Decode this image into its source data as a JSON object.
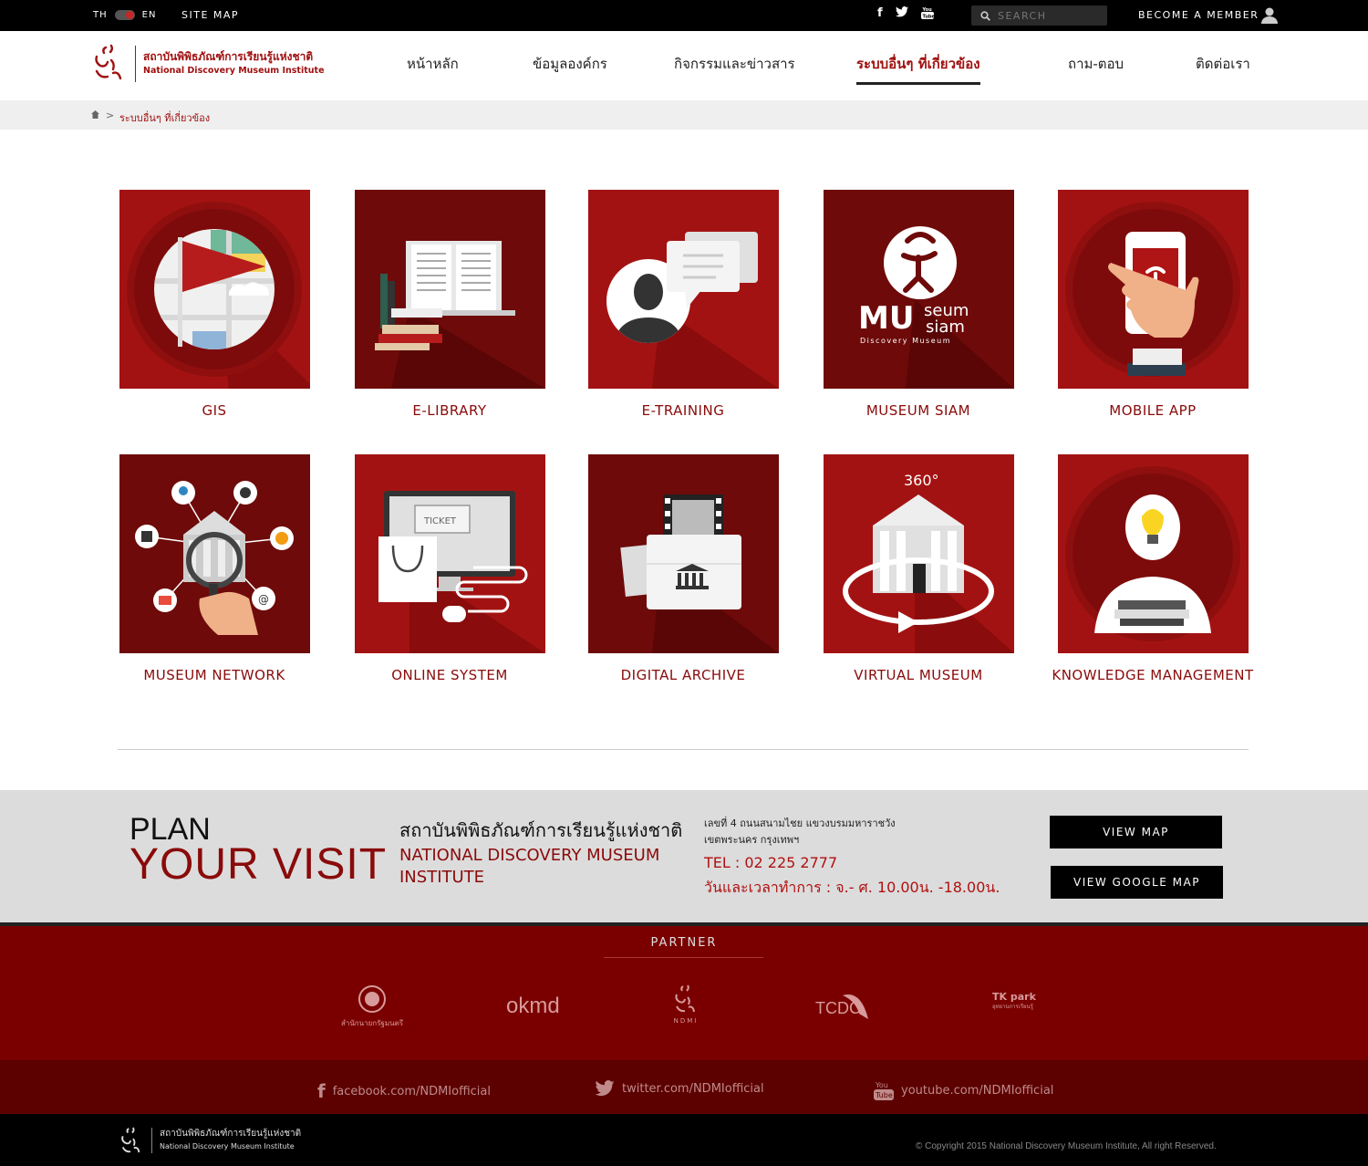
{
  "topbar": {
    "lang_th": "TH",
    "lang_en": "EN",
    "sitemap": "SITE MAP",
    "social_icons": [
      "facebook-icon",
      "twitter-icon",
      "youtube-icon"
    ],
    "search_placeholder": "SEARCH",
    "become_member": "BECOME A MEMBER"
  },
  "header": {
    "logo_th": "สถาบันพิพิธภัณฑ์การเรียนรู้แห่งชาติ",
    "logo_en": "National Discovery Museum Institute",
    "nav": [
      "หน้าหลัก",
      "ข้อมูลองค์กร",
      "กิจกรรมและข่าวสาร",
      "ระบบอื่นๆ ที่เกี่ยวข้อง",
      "ถาม-ตอบ",
      "ติดต่อเรา"
    ],
    "active_nav": "ระบบอื่นๆ ที่เกี่ยวข้อง"
  },
  "breadcrumb": {
    "separator": ">",
    "current": "ระบบอื่นๆ ที่เกี่ยวข้อง"
  },
  "tiles": [
    {
      "label": "GIS"
    },
    {
      "label": "E-LIBRARY"
    },
    {
      "label": "E-TRAINING"
    },
    {
      "label": "MUSEUM SIAM"
    },
    {
      "label": "MOBILE APP"
    },
    {
      "label": "MUSEUM NETWORK"
    },
    {
      "label": "ONLINE SYSTEM"
    },
    {
      "label": "DIGITAL ARCHIVE"
    },
    {
      "label": "VIRTUAL MUSEUM"
    },
    {
      "label": "KNOWLEDGE MANAGEMENT"
    }
  ],
  "tile_art": {
    "ticket": "TICKET",
    "degrees": "360°",
    "museum_siam_mu": "MU",
    "museum_siam_seum": "seum",
    "museum_siam_siam": "siam",
    "museum_siam_sub": "Discovery Museum"
  },
  "plan": {
    "line1": "PLAN",
    "line2": "YOUR VISIT",
    "org_th": "สถาบันพิพิธภัณฑ์การเรียนรู้แห่งชาติ",
    "org_en": "NATIONAL DISCOVERY MUSEUM INSTITUTE",
    "address1": "เลขที่ 4 ถนนสนามไชย แขวงบรมมหาราชวัง",
    "address2": "เขตพระนคร กรุงเทพฯ",
    "tel": "TEL : 02 225 2777",
    "hours": "วันและเวลาทำการ : จ.- ศ. 10.00น. -18.00น.",
    "view_map": "VIEW MAP",
    "view_google_map": "VIEW GOOGLE MAP"
  },
  "partner": {
    "title": "PARTNER",
    "logos": [
      "สำนักนายกรัฐมนตรี",
      "okmd",
      "NDMI",
      "TCDC",
      "TK park",
      "อุทยานการเรียนรู้"
    ]
  },
  "social_footer": {
    "facebook": "facebook.com/NDMIofficial",
    "twitter": "twitter.com/NDMIofficial",
    "youtube": "youtube.com/NDMIofficial"
  },
  "footer": {
    "logo_th": "สถาบันพิพิธภัณฑ์การเรียนรู้แห่งชาติ",
    "logo_en": "National Discovery Museum Institute",
    "copyright": "© Copyright 2015 National Discovery Museum Institute, All right Reserved."
  },
  "colors": {
    "brand_red": "#8a0a0a",
    "tile_red": "#a31212",
    "tile_dark": "#6e0a0a"
  }
}
